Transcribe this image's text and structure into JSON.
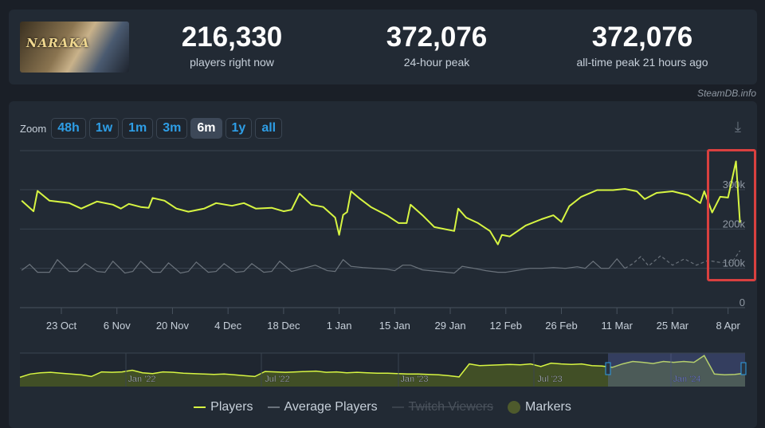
{
  "header": {
    "game_logo_text": "NARAKA",
    "stats": [
      {
        "value": "216,330",
        "label": "players right now"
      },
      {
        "value": "372,076",
        "label": "24-hour peak"
      },
      {
        "value": "372,076",
        "label": "all-time peak 21 hours ago"
      }
    ],
    "credit": "SteamDB.info"
  },
  "zoom": {
    "label": "Zoom",
    "options": [
      "48h",
      "1w",
      "1m",
      "3m",
      "6m",
      "1y",
      "all"
    ],
    "active": "6m",
    "download_icon": "download-icon"
  },
  "colors": {
    "players": "#d7f542",
    "average": "#6b737c",
    "accent": "#2e9ee6",
    "annotation": "#d9403f"
  },
  "chart_data": {
    "type": "line",
    "y_ticks": [
      "0",
      "100k",
      "200k",
      "300k"
    ],
    "ylim": [
      0,
      400000
    ],
    "x_ticks": [
      "23 Oct",
      "6 Nov",
      "20 Nov",
      "4 Dec",
      "18 Dec",
      "1 Jan",
      "15 Jan",
      "29 Jan",
      "12 Feb",
      "26 Feb",
      "11 Mar",
      "25 Mar",
      "8 Apr"
    ],
    "grid": true,
    "series": [
      {
        "name": "Players",
        "points": [
          [
            "2023-10-13",
            272000
          ],
          [
            "2023-10-16",
            245000
          ],
          [
            "2023-10-17",
            297000
          ],
          [
            "2023-10-20",
            272000
          ],
          [
            "2023-10-25",
            266000
          ],
          [
            "2023-10-28",
            252000
          ],
          [
            "2023-11-01",
            270000
          ],
          [
            "2023-11-05",
            262000
          ],
          [
            "2023-11-07",
            252000
          ],
          [
            "2023-11-09",
            264000
          ],
          [
            "2023-11-12",
            256000
          ],
          [
            "2023-11-14",
            254000
          ],
          [
            "2023-11-15",
            279000
          ],
          [
            "2023-11-18",
            272000
          ],
          [
            "2023-11-21",
            252000
          ],
          [
            "2023-11-24",
            244000
          ],
          [
            "2023-11-28",
            252000
          ],
          [
            "2023-12-01",
            266000
          ],
          [
            "2023-12-05",
            259000
          ],
          [
            "2023-12-08",
            266000
          ],
          [
            "2023-12-11",
            252000
          ],
          [
            "2023-12-15",
            254000
          ],
          [
            "2023-12-18",
            245000
          ],
          [
            "2023-12-20",
            249000
          ],
          [
            "2023-12-22",
            290000
          ],
          [
            "2023-12-25",
            262000
          ],
          [
            "2023-12-28",
            256000
          ],
          [
            "2023-12-31",
            229000
          ],
          [
            "2024-01-01",
            185000
          ],
          [
            "2024-01-02",
            236000
          ],
          [
            "2024-01-03",
            243000
          ],
          [
            "2024-01-04",
            296000
          ],
          [
            "2024-01-06",
            279000
          ],
          [
            "2024-01-09",
            256000
          ],
          [
            "2024-01-13",
            235000
          ],
          [
            "2024-01-16",
            215000
          ],
          [
            "2024-01-18",
            215000
          ],
          [
            "2024-01-19",
            262000
          ],
          [
            "2024-01-22",
            235000
          ],
          [
            "2024-01-25",
            205000
          ],
          [
            "2024-01-30",
            195000
          ],
          [
            "2024-01-31",
            252000
          ],
          [
            "2024-02-02",
            229000
          ],
          [
            "2024-02-05",
            215000
          ],
          [
            "2024-02-08",
            195000
          ],
          [
            "2024-02-10",
            161000
          ],
          [
            "2024-02-11",
            185000
          ],
          [
            "2024-02-13",
            181000
          ],
          [
            "2024-02-17",
            209000
          ],
          [
            "2024-02-21",
            225000
          ],
          [
            "2024-02-24",
            235000
          ],
          [
            "2024-02-26",
            218000
          ],
          [
            "2024-02-28",
            258000
          ],
          [
            "2024-03-02",
            282000
          ],
          [
            "2024-03-06",
            299000
          ],
          [
            "2024-03-10",
            299000
          ],
          [
            "2024-03-13",
            302000
          ],
          [
            "2024-03-16",
            296000
          ],
          [
            "2024-03-18",
            276000
          ],
          [
            "2024-03-21",
            292000
          ],
          [
            "2024-03-25",
            296000
          ],
          [
            "2024-03-29",
            286000
          ],
          [
            "2024-04-01",
            266000
          ],
          [
            "2024-04-02",
            296000
          ],
          [
            "2024-04-04",
            242000
          ],
          [
            "2024-04-06",
            282000
          ],
          [
            "2024-04-08",
            280000
          ],
          [
            "2024-04-10",
            372076
          ],
          [
            "2024-04-11",
            216330
          ]
        ]
      },
      {
        "name": "Average Players",
        "points": [
          [
            "2023-10-13",
            95000
          ],
          [
            "2023-10-15",
            110000
          ],
          [
            "2023-10-17",
            90000
          ],
          [
            "2023-10-20",
            90000
          ],
          [
            "2023-10-22",
            122000
          ],
          [
            "2023-10-25",
            92000
          ],
          [
            "2023-10-27",
            92000
          ],
          [
            "2023-10-29",
            112000
          ],
          [
            "2023-11-01",
            92000
          ],
          [
            "2023-11-03",
            90000
          ],
          [
            "2023-11-05",
            118000
          ],
          [
            "2023-11-08",
            88000
          ],
          [
            "2023-11-10",
            92000
          ],
          [
            "2023-11-12",
            118000
          ],
          [
            "2023-11-15",
            90000
          ],
          [
            "2023-11-17",
            90000
          ],
          [
            "2023-11-19",
            114000
          ],
          [
            "2023-11-22",
            88000
          ],
          [
            "2023-11-24",
            92000
          ],
          [
            "2023-11-26",
            116000
          ],
          [
            "2023-11-29",
            90000
          ],
          [
            "2023-12-01",
            92000
          ],
          [
            "2023-12-03",
            112000
          ],
          [
            "2023-12-06",
            90000
          ],
          [
            "2023-12-08",
            92000
          ],
          [
            "2023-12-10",
            112000
          ],
          [
            "2023-12-13",
            90000
          ],
          [
            "2023-12-15",
            92000
          ],
          [
            "2023-12-17",
            118000
          ],
          [
            "2023-12-20",
            92000
          ],
          [
            "2023-12-23",
            100000
          ],
          [
            "2023-12-26",
            108000
          ],
          [
            "2023-12-29",
            94000
          ],
          [
            "2023-12-31",
            92000
          ],
          [
            "2024-01-02",
            122000
          ],
          [
            "2024-01-04",
            105000
          ],
          [
            "2024-01-07",
            102000
          ],
          [
            "2024-01-10",
            100000
          ],
          [
            "2024-01-13",
            98000
          ],
          [
            "2024-01-15",
            94000
          ],
          [
            "2024-01-17",
            108000
          ],
          [
            "2024-01-19",
            108000
          ],
          [
            "2024-01-22",
            96000
          ],
          [
            "2024-01-25",
            93000
          ],
          [
            "2024-01-28",
            90000
          ],
          [
            "2024-01-30",
            88000
          ],
          [
            "2024-02-01",
            105000
          ],
          [
            "2024-02-04",
            100000
          ],
          [
            "2024-02-07",
            94000
          ],
          [
            "2024-02-10",
            90000
          ],
          [
            "2024-02-12",
            90000
          ],
          [
            "2024-02-15",
            95000
          ],
          [
            "2024-02-18",
            100000
          ],
          [
            "2024-02-21",
            100000
          ],
          [
            "2024-02-24",
            102000
          ],
          [
            "2024-02-27",
            100000
          ],
          [
            "2024-03-01",
            104000
          ],
          [
            "2024-03-03",
            100000
          ],
          [
            "2024-03-05",
            118000
          ],
          [
            "2024-03-07",
            100000
          ],
          [
            "2024-03-09",
            100000
          ],
          [
            "2024-03-11",
            124000
          ],
          [
            "2024-03-13",
            100000
          ],
          [
            "2024-03-15",
            112000
          ],
          [
            "2024-03-17",
            130000
          ],
          [
            "2024-03-19",
            106000
          ],
          [
            "2024-03-22",
            132000
          ],
          [
            "2024-03-25",
            108000
          ],
          [
            "2024-03-28",
            124000
          ],
          [
            "2024-03-31",
            108000
          ],
          [
            "2024-04-03",
            120000
          ],
          [
            "2024-04-06",
            115000
          ],
          [
            "2024-04-09",
            115000
          ],
          [
            "2024-04-11",
            145000
          ]
        ]
      }
    ],
    "navigator": {
      "labels": [
        "Jan '22",
        "Jul '22",
        "Jan '23",
        "Jul '23",
        "Jan '24"
      ],
      "values": [
        110,
        150,
        165,
        170,
        160,
        150,
        140,
        120,
        175,
        170,
        175,
        195,
        165,
        155,
        175,
        170,
        160,
        155,
        150,
        145,
        150,
        140,
        130,
        120,
        180,
        175,
        170,
        175,
        180,
        185,
        170,
        175,
        165,
        170,
        165,
        160,
        160,
        155,
        150,
        150,
        145,
        140,
        130,
        115,
        270,
        250,
        255,
        260,
        265,
        260,
        270,
        240,
        280,
        270,
        265,
        270,
        250,
        245,
        230,
        270,
        300,
        290,
        275,
        300,
        290,
        300,
        290,
        370,
        150,
        140,
        145,
        160
      ]
    }
  },
  "legend": [
    {
      "label": "Players",
      "enabled": true
    },
    {
      "label": "Average Players",
      "enabled": true
    },
    {
      "label": "Twitch Viewers",
      "enabled": false
    },
    {
      "label": "Markers",
      "enabled": true
    }
  ]
}
